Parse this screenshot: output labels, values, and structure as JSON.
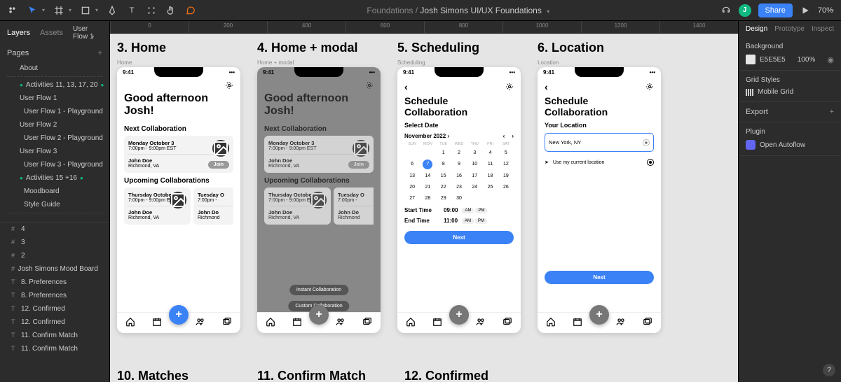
{
  "toolbar": {
    "breadcrumb_project": "Foundations",
    "breadcrumb_file": "Josh Simons UI/UX Foundations",
    "avatar_initial": "J",
    "share_label": "Share",
    "zoom": "70%"
  },
  "left_panel": {
    "tabs": [
      "Layers",
      "Assets"
    ],
    "active_tab": 0,
    "flow_label": "User Flow 1",
    "pages_label": "Pages",
    "pages": [
      {
        "label": "About",
        "indent": 1
      },
      {
        "label": "-----",
        "divider": true
      },
      {
        "label": "Activities 11, 13, 17, 20",
        "dot": true,
        "indent": 1
      },
      {
        "label": "User Flow 1",
        "indent": 1
      },
      {
        "label": "User Flow 1 - Playground",
        "indent": 2
      },
      {
        "label": "User Flow 2",
        "indent": 1
      },
      {
        "label": "User Flow 2 - Playground",
        "indent": 2
      },
      {
        "label": "User Flow 3",
        "indent": 1
      },
      {
        "label": "User Flow 3 - Playground",
        "indent": 2
      },
      {
        "label": "Activities 15 +16",
        "dot": true,
        "indent": 1
      },
      {
        "label": "Moodboard",
        "indent": 2
      },
      {
        "label": "Style Guide",
        "indent": 2
      },
      {
        "label": "-----",
        "divider": true
      }
    ],
    "layers": [
      {
        "icon": "#",
        "label": "4"
      },
      {
        "icon": "#",
        "label": "3"
      },
      {
        "icon": "#",
        "label": "2"
      },
      {
        "icon": "#",
        "label": "Josh Simons Mood Board"
      },
      {
        "icon": "T",
        "label": "8. Preferences"
      },
      {
        "icon": "T",
        "label": "8. Preferences"
      },
      {
        "icon": "T",
        "label": "12. Confirmed"
      },
      {
        "icon": "T",
        "label": "12. Confirmed"
      },
      {
        "icon": "T",
        "label": "11. Confirm Match"
      },
      {
        "icon": "T",
        "label": "11. Confirm Match"
      }
    ]
  },
  "ruler_marks": [
    "0",
    "200",
    "400",
    "600",
    "800",
    "1000",
    "1200",
    "1400"
  ],
  "artboards": [
    {
      "title": "3. Home",
      "label": "Home",
      "status_time": "9:41",
      "greeting": "Good afternoon Josh!",
      "section1": "Next Collaboration",
      "card1_line1": "Monday October 3",
      "card1_line2": "7:00pm - 9:00pm EST",
      "card1_name": "John Doe",
      "card1_loc": "Richmond, VA",
      "join": "Join",
      "section2": "Upcoming Collaborations",
      "card2_line1": "Thursday October 13",
      "card2_line2": "7:00pm - 9:00pm EST",
      "card2_name": "John Doe",
      "card2_loc": "Richmond, VA",
      "card3_line1": "Tuesday O",
      "card3_line2": "7:00pm -",
      "card3_name": "John Do",
      "card3_loc": "Richmond"
    },
    {
      "title": "4. Home + modal",
      "label": "Home + modal",
      "modal1": "Instant Collaboration",
      "modal2": "Custom Collaboration"
    },
    {
      "title": "5. Scheduling",
      "label": "Scheduling",
      "status_time": "9:41",
      "heading": "Schedule Collaboration",
      "select_date": "Select Date",
      "month": "November 2022",
      "dow": [
        "SUN",
        "MON",
        "TUE",
        "WED",
        "THU",
        "FRI",
        "SAT"
      ],
      "selected_day": 7,
      "start_label": "Start Time",
      "start_val": "09:00",
      "end_label": "End Time",
      "end_val": "11:00",
      "am": "AM",
      "pm": "PM",
      "next": "Next"
    },
    {
      "title": "6. Location",
      "label": "Location",
      "status_time": "9:41",
      "heading": "Schedule Collaboration",
      "your_location": "Your Location",
      "input_value": "New York, NY",
      "use_current": "Use my current location",
      "next": "Next"
    }
  ],
  "peek_titles": [
    "10. Matches",
    "11. Confirm Match",
    "12. Confirmed"
  ],
  "right_panel": {
    "tabs": [
      "Design",
      "Prototype",
      "Inspect"
    ],
    "active_tab": 0,
    "background_label": "Background",
    "bg_value": "E5E5E5",
    "bg_opacity": "100%",
    "grid_styles_label": "Grid Styles",
    "grid_name": "Mobile Grid",
    "export_label": "Export",
    "plugin_label": "Plugin",
    "plugin_name": "Open Autoflow"
  }
}
